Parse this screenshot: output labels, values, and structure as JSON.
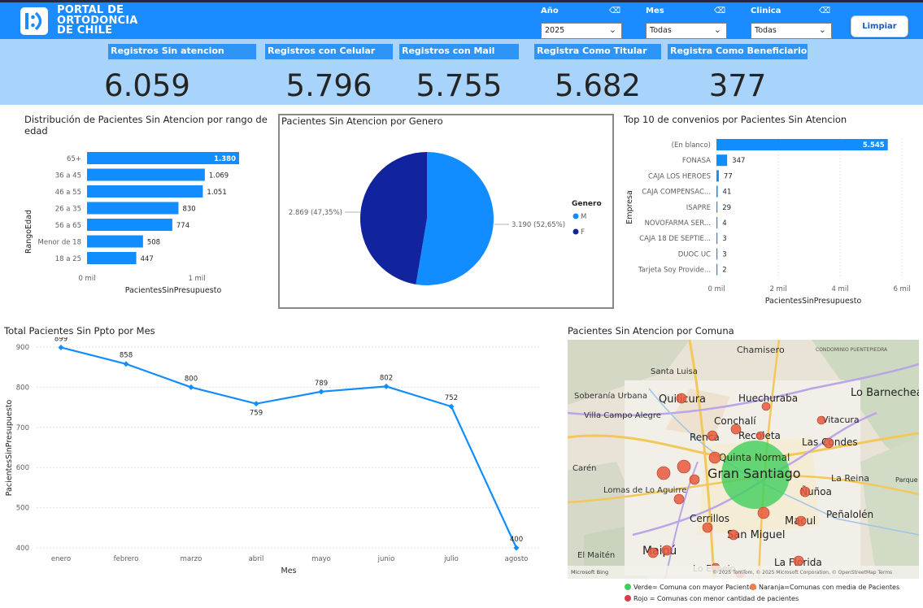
{
  "header": {
    "logo_text": [
      "PORTAL DE",
      "ORTODONCIA",
      "DE CHILE"
    ],
    "slicers": [
      {
        "label": "Año",
        "value": "2025"
      },
      {
        "label": "Mes",
        "value": "Todas"
      },
      {
        "label": "Clinica",
        "value": "Todas"
      }
    ],
    "clear_button": "Limpiar"
  },
  "kpis": [
    {
      "title": "Registros Sin atencion",
      "value": "6.059"
    },
    {
      "title": "Registros con Celular",
      "value": "5.796"
    },
    {
      "title": "Registros con Mail",
      "value": "5.755"
    },
    {
      "title": "Registra Como Titular",
      "value": "5.682"
    },
    {
      "title": "Registra Como Beneficiario",
      "value": "377"
    }
  ],
  "age_chart": {
    "title": "Distribución de Pacientes Sin Atencion por rango de edad",
    "y_axis_title": "RangoEdad",
    "x_axis_title": "PacientesSinPresupuesto",
    "x_ticks": [
      "0 mil",
      "1 mil"
    ]
  },
  "gender_chart": {
    "title": "Pacientes Sin Atencion por Genero",
    "legend_title": "Genero",
    "legend_items": [
      "M",
      "F"
    ],
    "labels": [
      "3.190 (52,65%)",
      "2.869 (47,35%)"
    ]
  },
  "convenios_chart": {
    "title": "Top 10 de convenios por Pacientes Sin Atencion",
    "y_axis_title": "Empresa",
    "x_axis_title": "PacientesSinPresupuesto",
    "x_ticks": [
      "0 mil",
      "2 mil",
      "4 mil",
      "6 mil"
    ]
  },
  "monthly_chart": {
    "title": "Total Pacientes Sin Ppto por Mes",
    "y_axis_title": "PacientesSinPresupuesto",
    "x_axis_title": "Mes"
  },
  "map": {
    "title": "Pacientes Sin Atencion por Comuna",
    "places": [
      "Chamisero",
      "CONDOMINIO PUENTEPIEDRA",
      "Santa Luisa",
      "Soberanía Urbana",
      "Quilicura",
      "Huechuraba",
      "Lo Barnechea",
      "Villa Campo Alegre",
      "Conchalí",
      "Vitacura",
      "Renca",
      "Recoleta",
      "Las Condes",
      "Quinta Normal",
      "Carén",
      "Gran Santiago",
      "La Reina",
      "Parque Meh",
      "Lomas de Lo Aguirre",
      "Ñuñoa",
      "Cerrillos",
      "Macul",
      "Peñalolén",
      "San Miguel",
      "El Maitén",
      "Maipú",
      "Lo Espejo",
      "La Florida"
    ],
    "attribution": "© 2025 TomTom, © 2025 Microsoft Corporation, © OpenStreetMap  Terms",
    "bing": "Microsoft Bing",
    "legend": [
      {
        "text": "Verde= Comuna con mayor Pacientes",
        "color": "#3ecf5b"
      },
      {
        "text": "Naranja=Comunas con media de Pacientes",
        "color": "#f07d4a"
      },
      {
        "text": "Rojo = Comunas con menor cantidad de pacientes",
        "color": "#e0394a"
      }
    ]
  },
  "chart_data": [
    {
      "type": "bar",
      "orientation": "horizontal",
      "title": "Distribución de Pacientes Sin Atencion por rango de edad",
      "xlabel": "PacientesSinPresupuesto",
      "ylabel": "RangoEdad",
      "categories": [
        "65+",
        "36 a 45",
        "46 a 55",
        "26 a 35",
        "56 a 65",
        "Menor de 18",
        "18 a 25"
      ],
      "values": [
        1380,
        1069,
        1051,
        830,
        774,
        508,
        447
      ],
      "value_labels": [
        "1.380",
        "1.069",
        "1.051",
        "830",
        "774",
        "508",
        "447"
      ],
      "xlim": [
        0,
        1380
      ],
      "color": "#118dff"
    },
    {
      "type": "pie",
      "title": "Pacientes Sin Atencion por Genero",
      "categories": [
        "M",
        "F"
      ],
      "values": [
        3190,
        2869
      ],
      "percentages": [
        52.65,
        47.35
      ],
      "colors": [
        "#118dff",
        "#12239e"
      ],
      "legend": "right"
    },
    {
      "type": "bar",
      "orientation": "horizontal",
      "title": "Top 10 de convenios por Pacientes Sin Atencion",
      "xlabel": "PacientesSinPresupuesto",
      "ylabel": "Empresa",
      "categories": [
        "(En blanco)",
        "FONASA",
        "CAJA LOS HEROES",
        "CAJA COMPENSAC...",
        "ISAPRE",
        "NOVOFARMA SER...",
        "CAJA 18 DE SEPTIE...",
        "DUOC UC",
        "Tarjeta Soy Provide..."
      ],
      "values": [
        5545,
        347,
        77,
        41,
        29,
        4,
        3,
        3,
        2
      ],
      "value_labels": [
        "5.545",
        "347",
        "77",
        "41",
        "29",
        "4",
        "3",
        "3",
        "2"
      ],
      "xlim": [
        0,
        6000
      ],
      "color": "#118dff"
    },
    {
      "type": "line",
      "title": "Total Pacientes Sin Ppto por Mes",
      "xlabel": "Mes",
      "ylabel": "PacientesSinPresupuesto",
      "x": [
        "enero",
        "febrero",
        "marzo",
        "abril",
        "mayo",
        "junio",
        "julio",
        "agosto"
      ],
      "values": [
        899,
        858,
        800,
        759,
        789,
        802,
        752,
        400
      ],
      "y_ticks": [
        400,
        500,
        600,
        700,
        800,
        900
      ],
      "ylim": [
        400,
        900
      ],
      "color": "#118dff",
      "grid": true
    }
  ]
}
